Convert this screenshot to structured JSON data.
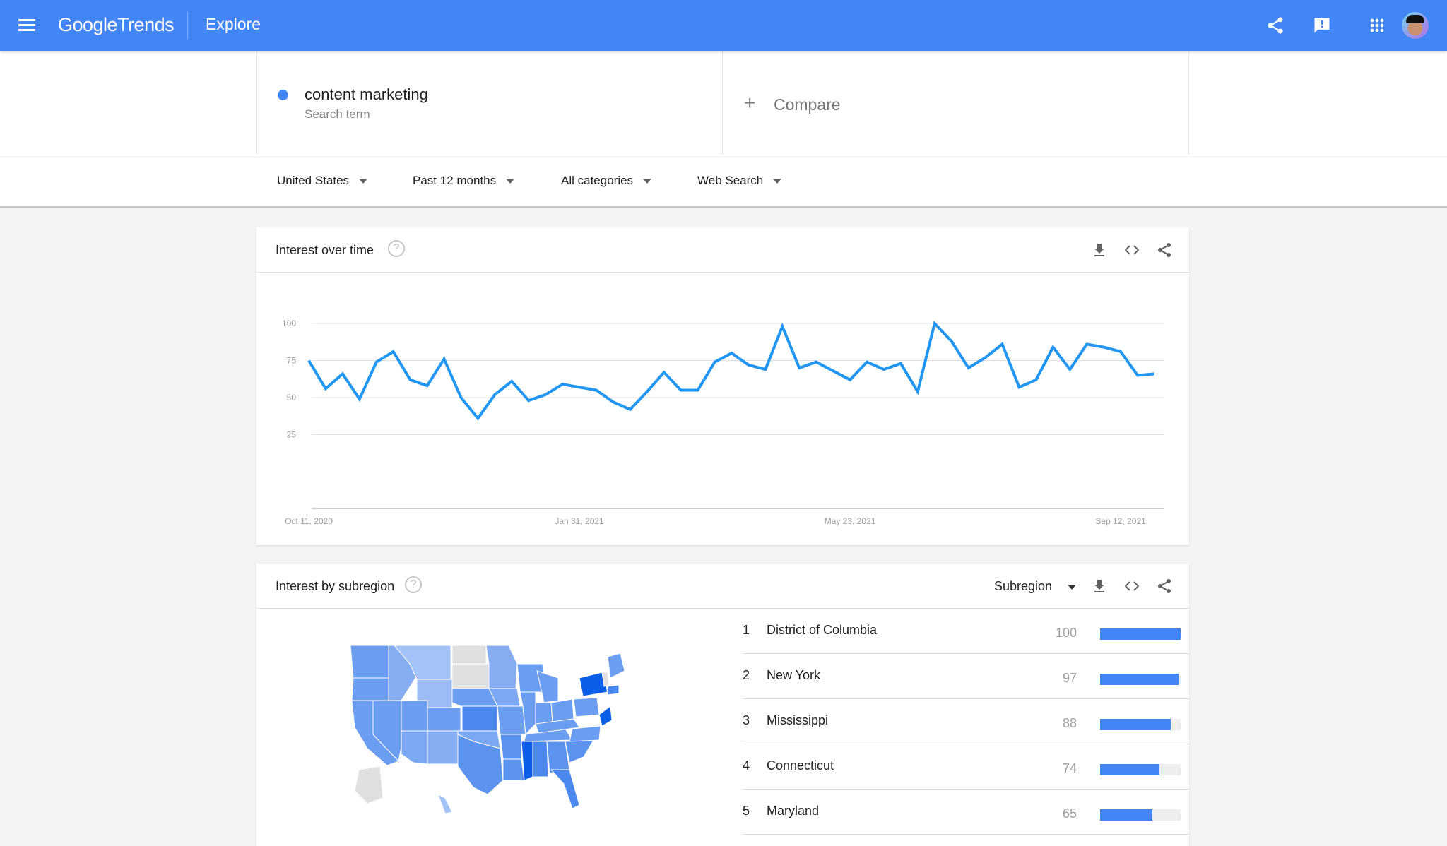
{
  "topbar": {
    "logo_google": "Google",
    "logo_trends": "Trends",
    "section": "Explore",
    "icons": [
      "menu-icon",
      "share-icon",
      "feedback-icon",
      "apps-grid-icon",
      "account-avatar"
    ],
    "brand_color": "#4285f4"
  },
  "search_term": {
    "name": "content marketing",
    "subtitle": "Search term",
    "color": "#4285f4"
  },
  "compare": {
    "label": "Compare",
    "icon": "plus-icon"
  },
  "filters": {
    "region": "United States",
    "time": "Past 12 months",
    "category": "All categories",
    "property": "Web Search"
  },
  "interest_over_time": {
    "title": "Interest over time",
    "help_glyph": "?",
    "actions": [
      "download-icon",
      "embed-icon",
      "share-icon"
    ]
  },
  "chart_data": {
    "type": "line",
    "title": "Interest over time",
    "xlabel": "",
    "ylabel": "",
    "ylim": [
      0,
      100
    ],
    "yticks": [
      25,
      50,
      75,
      100
    ],
    "x_tick_labels": [
      {
        "label": "Oct 11, 2020",
        "index": 0
      },
      {
        "label": "Jan 31, 2021",
        "index": 16
      },
      {
        "label": "May 23, 2021",
        "index": 32
      },
      {
        "label": "Sep 12, 2021",
        "index": 48
      }
    ],
    "grid": true,
    "series": [
      {
        "name": "content marketing",
        "color": "#2196f3",
        "values": [
          75,
          56,
          66,
          49,
          74,
          81,
          62,
          58,
          76,
          50,
          36,
          52,
          61,
          48,
          52,
          59,
          57,
          55,
          47,
          42,
          54,
          67,
          55,
          55,
          74,
          80,
          72,
          69,
          98,
          70,
          74,
          68,
          62,
          74,
          69,
          73,
          54,
          100,
          88,
          70,
          77,
          86,
          57,
          62,
          84,
          69,
          86,
          84,
          81,
          65,
          66
        ]
      }
    ]
  },
  "interest_by_subregion": {
    "title": "Interest by subregion",
    "help_glyph": "?",
    "selector": "Subregion",
    "actions": [
      "download-icon",
      "embed-icon",
      "share-icon"
    ],
    "ranking": [
      {
        "rank": "1",
        "name": "District of Columbia",
        "value": 100
      },
      {
        "rank": "2",
        "name": "New York",
        "value": 97
      },
      {
        "rank": "3",
        "name": "Mississippi",
        "value": 88
      },
      {
        "rank": "4",
        "name": "Connecticut",
        "value": 74
      },
      {
        "rank": "5",
        "name": "Maryland",
        "value": 65
      }
    ],
    "map_colors": {
      "highest": "#0b5ee6",
      "high": "#4a88ee",
      "medium": "#6b9df0",
      "low": "#a3c3f7",
      "no_data": "#e0e0e0"
    }
  }
}
